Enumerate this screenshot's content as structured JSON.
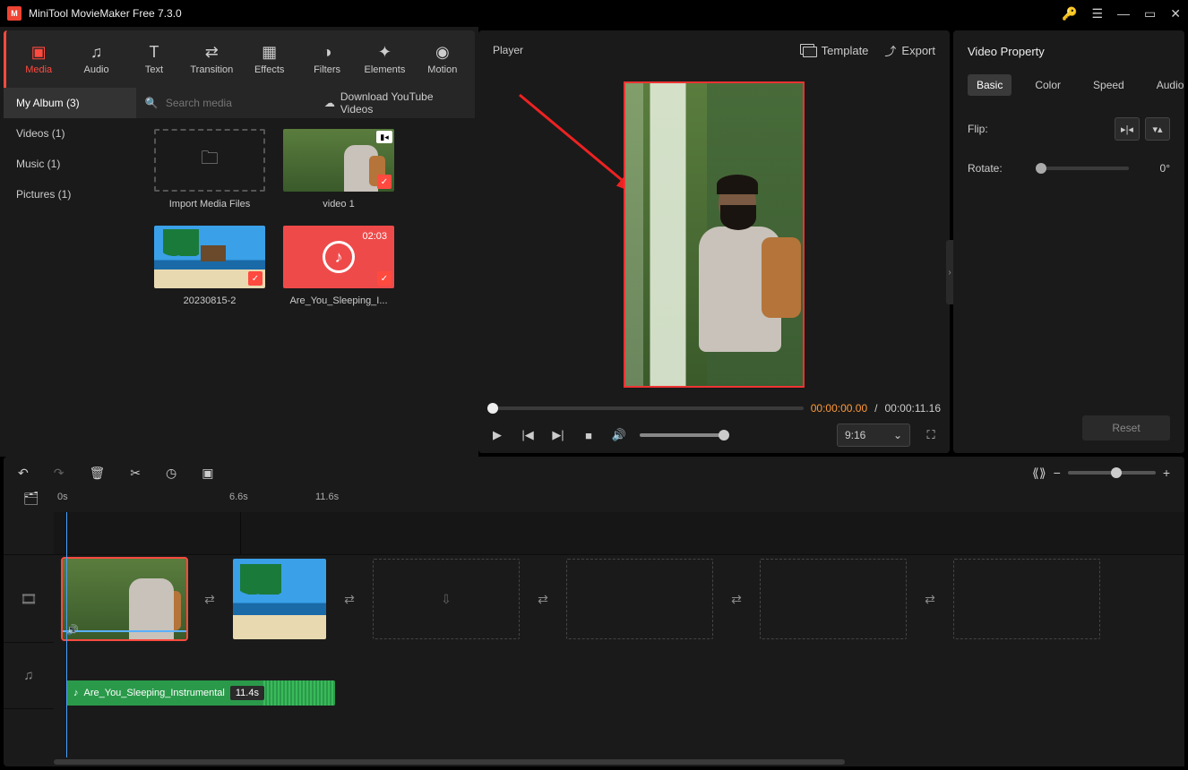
{
  "title": "MiniTool MovieMaker Free 7.3.0",
  "ribbon": [
    {
      "label": "Media",
      "icon": "folder-icon",
      "active": true
    },
    {
      "label": "Audio",
      "icon": "music-icon"
    },
    {
      "label": "Text",
      "icon": "text-icon"
    },
    {
      "label": "Transition",
      "icon": "transition-icon"
    },
    {
      "label": "Effects",
      "icon": "effects-icon"
    },
    {
      "label": "Filters",
      "icon": "filters-icon"
    },
    {
      "label": "Elements",
      "icon": "elements-icon"
    },
    {
      "label": "Motion",
      "icon": "motion-icon"
    }
  ],
  "sidebar": [
    {
      "label": "My Album (3)",
      "active": true
    },
    {
      "label": "Videos (1)"
    },
    {
      "label": "Music (1)"
    },
    {
      "label": "Pictures (1)"
    }
  ],
  "search": {
    "placeholder": "Search media"
  },
  "download_btn": "Download YouTube Videos",
  "media_items": [
    {
      "kind": "import",
      "label": "Import Media Files"
    },
    {
      "kind": "video",
      "label": "video 1",
      "thumb": "forest",
      "cam": true,
      "used": true
    },
    {
      "kind": "image",
      "label": "20230815-2",
      "thumb": "beach",
      "used": true
    },
    {
      "kind": "audio",
      "label": "Are_You_Sleeping_I...",
      "duration": "02:03",
      "used": true
    }
  ],
  "player": {
    "title": "Player",
    "template_btn": "Template",
    "export_btn": "Export",
    "current_time": "00:00:00.00",
    "total_time": "00:00:11.16",
    "aspect": "9:16"
  },
  "property": {
    "title": "Video Property",
    "tabs": [
      "Basic",
      "Color",
      "Speed",
      "Audio"
    ],
    "active_tab": 0,
    "flip_label": "Flip:",
    "rotate_label": "Rotate:",
    "rotate_value": "0°",
    "reset": "Reset"
  },
  "timeline": {
    "ticks": [
      "0s",
      "6.6s",
      "11.6s"
    ],
    "audio_clip": {
      "name": "Are_You_Sleeping_Instrumental",
      "duration": "11.4s"
    }
  }
}
